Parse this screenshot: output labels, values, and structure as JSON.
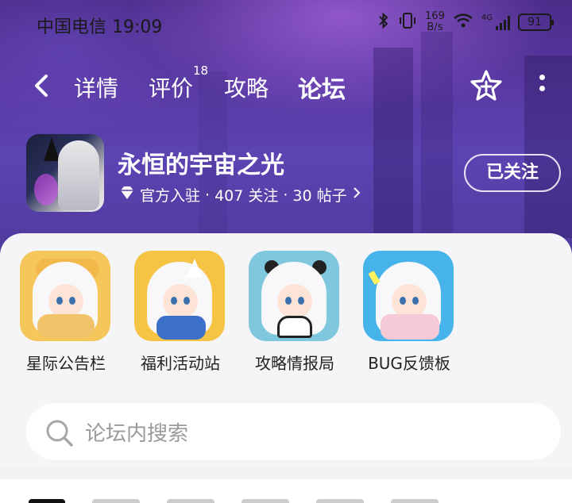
{
  "status_bar": {
    "carrier_time": "中国电信 19:09",
    "speed_value": "169",
    "speed_unit": "B/s",
    "network": "4G",
    "battery": "91",
    "icons": [
      "bluetooth-icon",
      "vibrate-icon",
      "wifi-icon",
      "signal-icon",
      "battery-icon"
    ]
  },
  "nav": {
    "back_icon": "chevron-left-icon",
    "tabs": [
      {
        "label": "详情",
        "active": false
      },
      {
        "label": "评价",
        "badge": "18",
        "active": false
      },
      {
        "label": "攻略",
        "active": false
      },
      {
        "label": "论坛",
        "active": true
      }
    ],
    "favorite_icon": "star-plus-icon",
    "more_icon": "more-vertical-icon"
  },
  "game": {
    "title": "永恒的宇宙之光",
    "verified_label": "官方入驻",
    "follow_count": "407 关注",
    "post_count": "30 帖子",
    "separator": "·",
    "follow_button": "已关注"
  },
  "boards": [
    {
      "name": "星际公告栏"
    },
    {
      "name": "福利活动站"
    },
    {
      "name": "攻略情报局"
    },
    {
      "name": "BUG反馈板"
    }
  ],
  "search": {
    "placeholder": "论坛内搜索"
  },
  "colors": {
    "accent": "#36d6c4",
    "hero": "#5a3aa4"
  }
}
